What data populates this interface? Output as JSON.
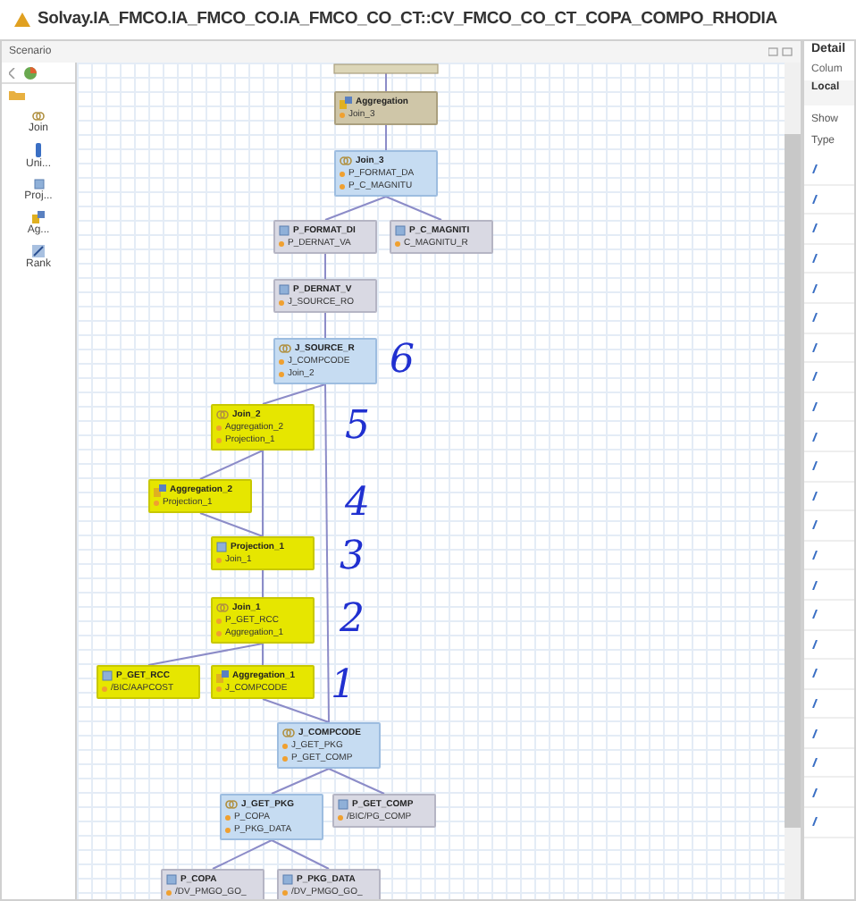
{
  "window": {
    "title": "Solvay.IA_FMCO.IA_FMCO_CO.IA_FMCO_CO_CT::CV_FMCO_CO_CT_COPA_COMPO_RHODIA"
  },
  "scenario": {
    "title": "Scenario",
    "palette": [
      {
        "kind": "join",
        "label": "Join"
      },
      {
        "kind": "union",
        "label": "Uni..."
      },
      {
        "kind": "projection",
        "label": "Proj..."
      },
      {
        "kind": "aggregation",
        "label": "Ag..."
      },
      {
        "kind": "rank",
        "label": "Rank"
      }
    ]
  },
  "nodes": [
    {
      "kind": "aggregation",
      "title": "Aggregation",
      "highlighted": false,
      "inputs": [
        "Join_3"
      ]
    },
    {
      "kind": "join",
      "title": "Join_3",
      "highlighted": false,
      "inputs": [
        "P_FORMAT_DA",
        "P_C_MAGNITU"
      ]
    },
    {
      "kind": "projection",
      "title": "P_FORMAT_DI",
      "highlighted": false,
      "inputs": [
        "P_DERNAT_VA"
      ]
    },
    {
      "kind": "projection",
      "title": "P_C_MAGNITI",
      "highlighted": false,
      "inputs": [
        "C_MAGNITU_R"
      ]
    },
    {
      "kind": "projection",
      "title": "P_DERNAT_V",
      "highlighted": false,
      "inputs": [
        "J_SOURCE_RO"
      ]
    },
    {
      "kind": "join",
      "title": "J_SOURCE_R",
      "highlighted": false,
      "inputs": [
        "J_COMPCODE",
        "Join_2"
      ]
    },
    {
      "kind": "join",
      "title": "Join_2",
      "highlighted": true,
      "inputs": [
        "Aggregation_2",
        "Projection_1"
      ]
    },
    {
      "kind": "aggregation",
      "title": "Aggregation_2",
      "highlighted": true,
      "inputs": [
        "Projection_1"
      ]
    },
    {
      "kind": "projection",
      "title": "Projection_1",
      "highlighted": true,
      "inputs": [
        "Join_1"
      ]
    },
    {
      "kind": "join",
      "title": "Join_1",
      "highlighted": true,
      "inputs": [
        "P_GET_RCC",
        "Aggregation_1"
      ]
    },
    {
      "kind": "projection",
      "title": "P_GET_RCC",
      "highlighted": true,
      "inputs": [
        "/BIC/AAPCOST"
      ]
    },
    {
      "kind": "aggregation",
      "title": "Aggregation_1",
      "highlighted": true,
      "inputs": [
        "J_COMPCODE"
      ]
    },
    {
      "kind": "join",
      "title": "J_COMPCODE",
      "highlighted": false,
      "inputs": [
        "J_GET_PKG",
        "P_GET_COMP"
      ]
    },
    {
      "kind": "join",
      "title": "J_GET_PKG",
      "highlighted": false,
      "inputs": [
        "P_COPA",
        "P_PKG_DATA"
      ]
    },
    {
      "kind": "projection",
      "title": "P_GET_COMP",
      "highlighted": false,
      "inputs": [
        "/BIC/PG_COMP"
      ]
    },
    {
      "kind": "projection",
      "title": "P_COPA",
      "highlighted": false,
      "inputs": [
        "/DV_PMGO_GO_"
      ]
    },
    {
      "kind": "projection",
      "title": "P_PKG_DATA",
      "highlighted": false,
      "inputs": [
        "/DV_PMGO_GO_"
      ]
    }
  ],
  "annotations": [
    "6",
    "5",
    "4",
    "3",
    "2",
    "1"
  ],
  "details": {
    "title": "Detail",
    "tab": "Colum",
    "section": "Local",
    "show_label": "Show",
    "column_header": "Type"
  }
}
